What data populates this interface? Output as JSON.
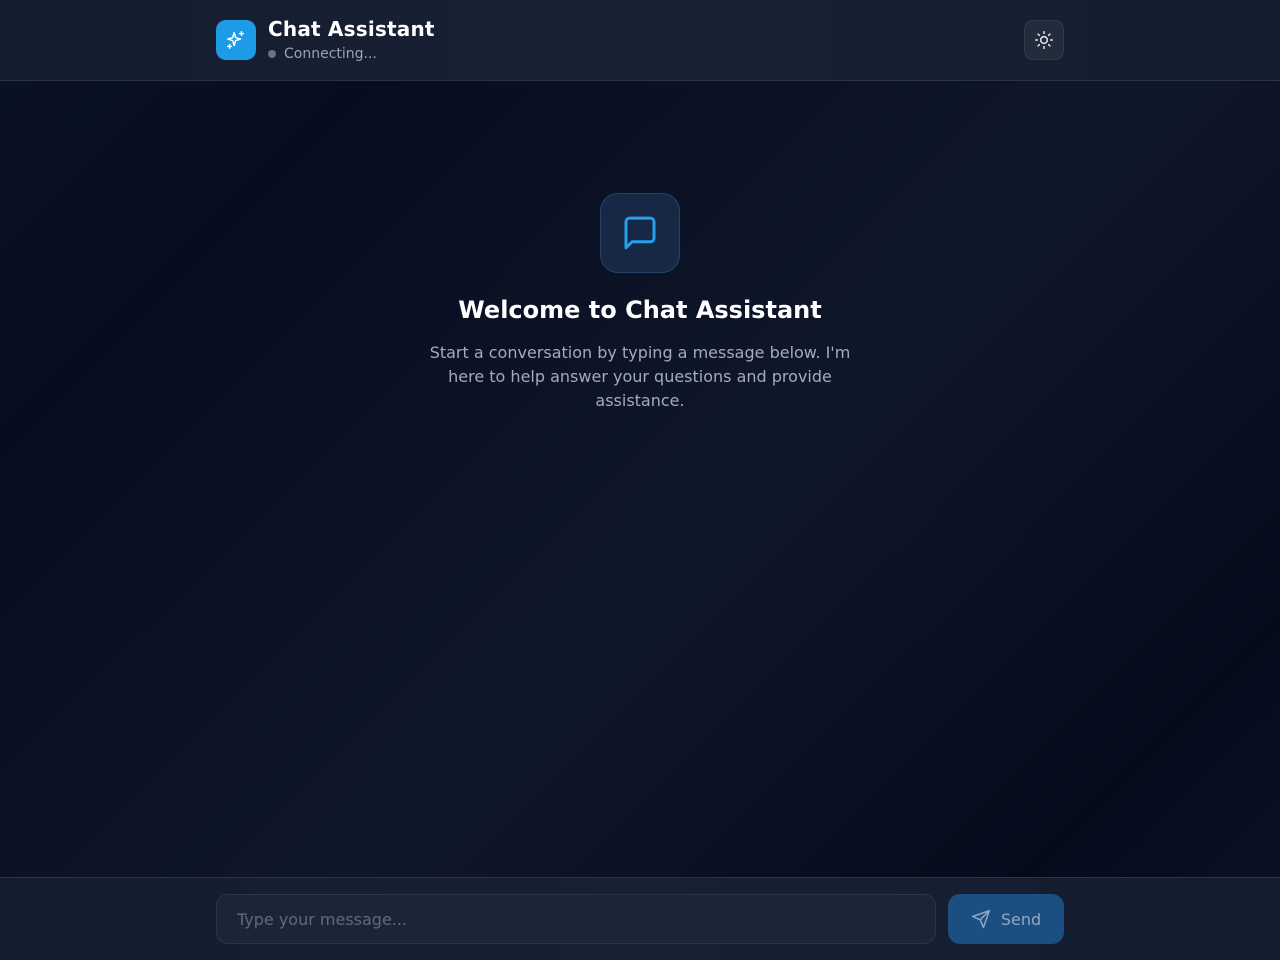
{
  "header": {
    "title": "Chat Assistant",
    "status_text": "Connecting...",
    "logo_icon": "sparkles-icon",
    "theme_icon": "sun-icon"
  },
  "welcome": {
    "icon": "message-square-icon",
    "title": "Welcome to Chat Assistant",
    "text": "Start a conversation by typing a message below. I'm here to help answer your questions and provide assistance."
  },
  "composer": {
    "placeholder": "Type your message...",
    "value": "",
    "send_label": "Send",
    "send_icon": "send-icon"
  },
  "colors": {
    "accent": "#1e9be6",
    "status_dot": "#6b7280",
    "send_button": "#1b4f82"
  }
}
